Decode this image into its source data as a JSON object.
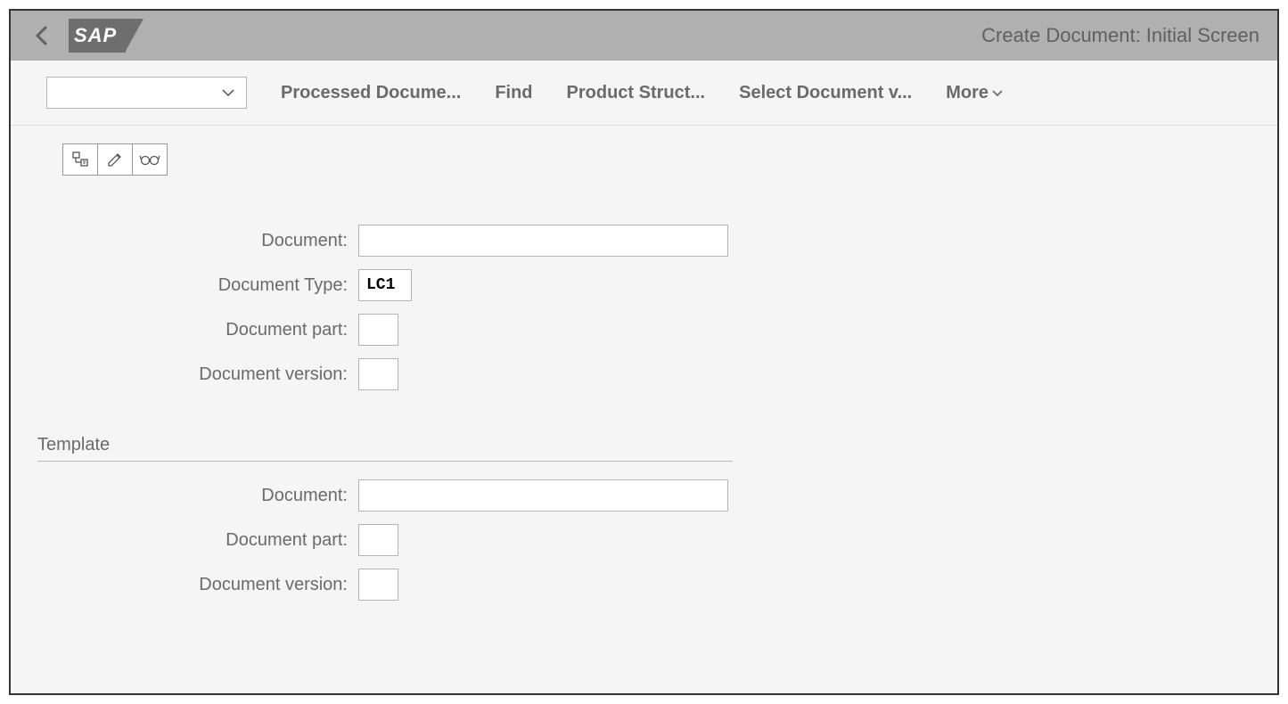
{
  "header": {
    "logo_text": "SAP",
    "title": "Create Document: Initial Screen"
  },
  "toolbar": {
    "dropdown_value": "",
    "items": {
      "processed": "Processed Docume...",
      "find": "Find",
      "product_struct": "Product Struct...",
      "select_doc": "Select Document v...",
      "more": "More"
    }
  },
  "icons": {
    "hierarchy": "hierarchy-icon",
    "edit": "pencil-icon",
    "display": "glasses-icon"
  },
  "main_form": {
    "document_label": "Document:",
    "document_value": "",
    "doc_type_label": "Document Type:",
    "doc_type_value": "LC1",
    "doc_part_label": "Document part:",
    "doc_part_value": "",
    "doc_version_label": "Document version:",
    "doc_version_value": ""
  },
  "template": {
    "section_title": "Template",
    "document_label": "Document:",
    "document_value": "",
    "doc_part_label": "Document part:",
    "doc_part_value": "",
    "doc_version_label": "Document version:",
    "doc_version_value": ""
  }
}
